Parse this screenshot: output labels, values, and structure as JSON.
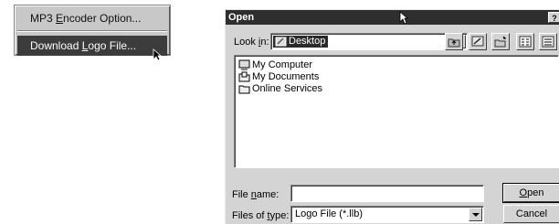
{
  "context_menu": {
    "items": [
      {
        "pre": "MP3 ",
        "key": "E",
        "post": "ncoder Option..."
      },
      {
        "pre": "Download ",
        "key": "L",
        "post": "ogo File..."
      }
    ]
  },
  "dialog": {
    "title": "Open",
    "help_label": "?",
    "look_in": {
      "pre": "Look ",
      "key": "i",
      "post": "n:",
      "value": "Desktop"
    },
    "files": [
      {
        "name": "My Computer",
        "icon": "computer-icon"
      },
      {
        "name": "My Documents",
        "icon": "folder-icon"
      },
      {
        "name": "Online Services",
        "icon": "folder-icon"
      }
    ],
    "file_name": {
      "pre": "File ",
      "key": "n",
      "post": "ame:",
      "value": ""
    },
    "file_type": {
      "pre": "Files of ",
      "key": "t",
      "post": "ype:",
      "value": "Logo File (*.llb)"
    },
    "open_button": {
      "key": "O",
      "post": "pen"
    },
    "cancel_button": "Cancel"
  },
  "colors": {
    "titlebar": "#2e2e2e",
    "selection": "#3c3c3c",
    "face": "#d4d4d4"
  }
}
